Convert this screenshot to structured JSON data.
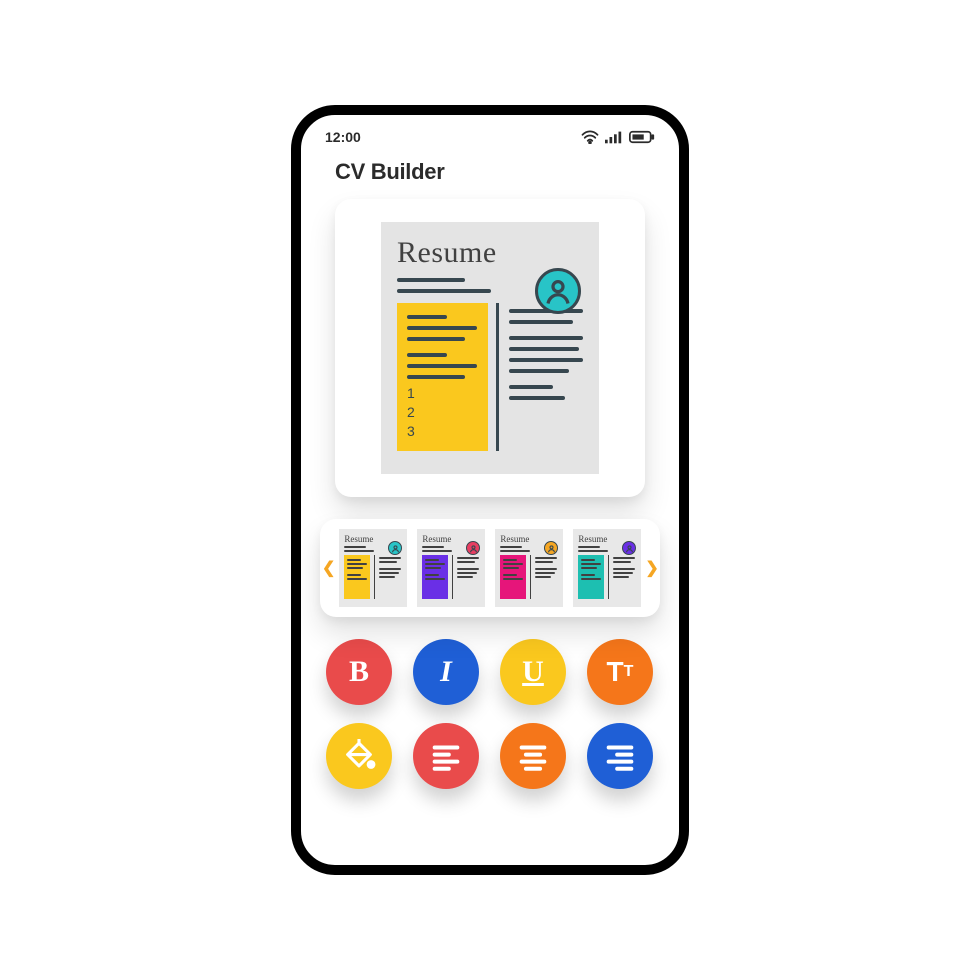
{
  "status": {
    "time": "12:00"
  },
  "header": {
    "title": "CV Builder"
  },
  "preview": {
    "doc_title": "Resume",
    "numbers": [
      "1",
      "2",
      "3"
    ],
    "accent": "#fac81e",
    "avatar_bg": "#28c4c7"
  },
  "templates": [
    {
      "label": "Resume",
      "accent": "#fac81e",
      "avatar": "#28c4c7"
    },
    {
      "label": "Resume",
      "accent": "#6a2fe6",
      "avatar": "#e83e62"
    },
    {
      "label": "Resume",
      "accent": "#e6157a",
      "avatar": "#f5a623"
    },
    {
      "label": "Resume",
      "accent": "#1dbfb1",
      "avatar": "#6a2fe6"
    }
  ],
  "tools": {
    "bold": {
      "label": "B",
      "bg": "#e94b4b"
    },
    "italic": {
      "label": "I",
      "bg": "#1f5fd6"
    },
    "underline": {
      "label": "U",
      "bg": "#fac81e"
    },
    "textsize": {
      "label": "Tᴛ",
      "bg": "#f5761a"
    },
    "fill": {
      "bg": "#fac81e"
    },
    "align_left": {
      "bg": "#e94b4b"
    },
    "align_center": {
      "bg": "#f5761a"
    },
    "align_right": {
      "bg": "#1f5fd6"
    }
  }
}
